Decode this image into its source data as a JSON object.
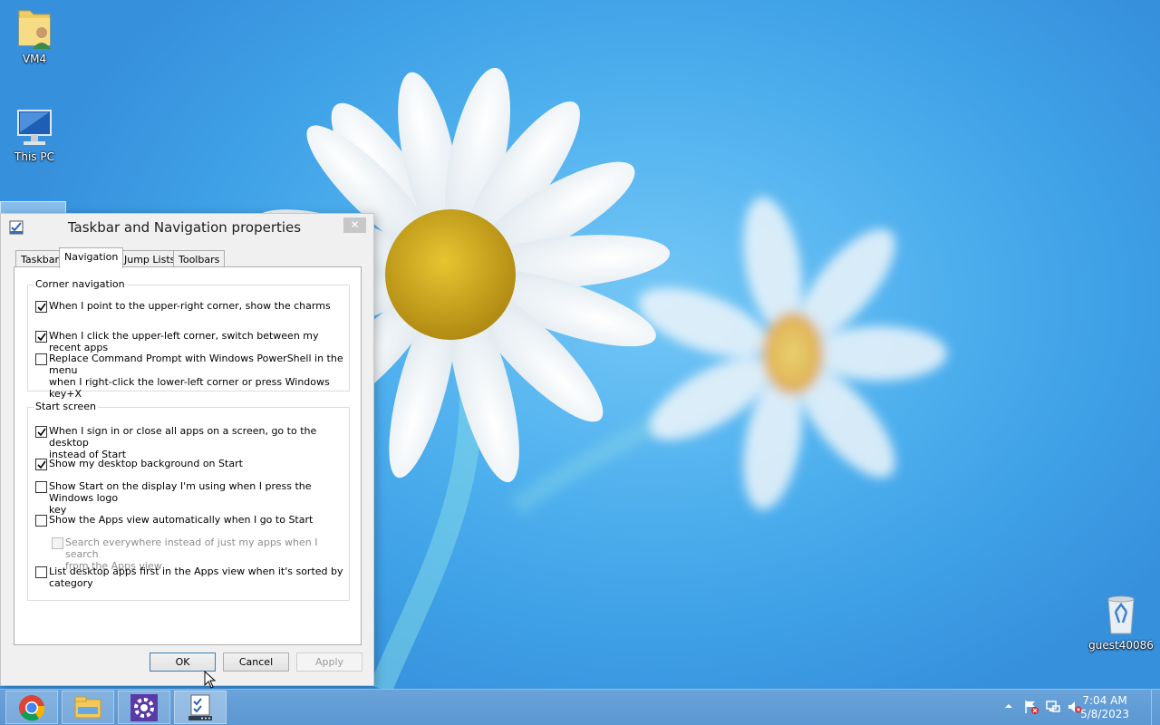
{
  "desktop": {
    "icons": [
      {
        "label": "VM4",
        "icon": "user-folder-icon"
      },
      {
        "label": "This PC",
        "icon": "computer-icon"
      },
      {
        "label": "guest40086",
        "icon": "recycle-bin-icon"
      }
    ]
  },
  "dialog": {
    "title": "Taskbar and Navigation properties",
    "close_label": "✕",
    "tabs": [
      "Taskbar",
      "Navigation",
      "Jump Lists",
      "Toolbars"
    ],
    "active_tab": "Navigation",
    "groups": [
      {
        "title": "Corner navigation",
        "options": [
          {
            "label": "When I point to the upper-right corner, show the charms",
            "checked": true,
            "enabled": true
          },
          {
            "label": "When I click the upper-left corner, switch between my recent apps",
            "checked": true,
            "enabled": true
          },
          {
            "label": "Replace Command Prompt with Windows PowerShell in the menu\nwhen I right-click the lower-left corner or press Windows key+X",
            "checked": false,
            "enabled": true
          }
        ]
      },
      {
        "title": "Start screen",
        "options": [
          {
            "label": "When I sign in or close all apps on a screen, go to the desktop\ninstead of Start",
            "checked": true,
            "enabled": true
          },
          {
            "label": "Show my desktop background on Start",
            "checked": true,
            "enabled": true
          },
          {
            "label": "Show Start on the display I'm using when I press the Windows logo\nkey",
            "checked": false,
            "enabled": true
          },
          {
            "label": "Show the Apps view automatically when I go to Start",
            "checked": false,
            "enabled": true
          },
          {
            "label": "Search everywhere instead of just my apps when I search\nfrom the Apps view",
            "checked": false,
            "enabled": false
          },
          {
            "label": "List desktop apps first in the Apps view when it's sorted by\ncategory",
            "checked": false,
            "enabled": true
          }
        ]
      }
    ],
    "buttons": {
      "ok": "OK",
      "cancel": "Cancel",
      "apply": "Apply"
    }
  },
  "taskbar": {
    "apps": [
      "chrome-icon",
      "file-explorer-icon",
      "control-panel-icon",
      "task-properties-icon"
    ],
    "tray": [
      "show-hidden-icons-arrow",
      "action-center-flag-icon",
      "network-icon",
      "volume-muted-icon"
    ],
    "time": "7:04 AM",
    "date": "5/8/2023"
  },
  "colors": {
    "accent": "#3c7fb1",
    "taskbar": "#5f9bd5",
    "desktop": "#3d9fe5"
  }
}
